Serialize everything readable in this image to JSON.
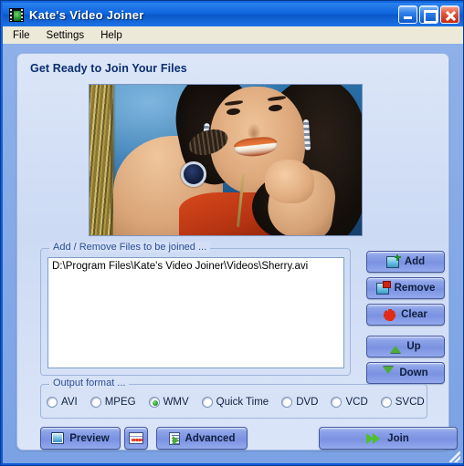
{
  "window": {
    "title": "Kate's Video Joiner",
    "app_icon": "film-app-icon",
    "controls": {
      "minimize": "minimize-icon",
      "maximize": "maximize-icon",
      "close": "close-icon"
    }
  },
  "menu": {
    "items": [
      {
        "label": "File"
      },
      {
        "label": "Settings"
      },
      {
        "label": "Help"
      }
    ]
  },
  "main": {
    "heading": "Get Ready to Join Your Files",
    "preview": {
      "name": "video-preview-thumbnail",
      "description": "Smiling woman with dark curly hair in orange top against blue backdrop"
    },
    "files_group": {
      "legend": "Add / Remove Files to be joined ...",
      "items": [
        "D:\\Program Files\\Kate's Video Joiner\\Videos\\Sherry.avi"
      ]
    },
    "side_buttons": [
      {
        "label": "Add",
        "icon": "add-image-icon"
      },
      {
        "label": "Remove",
        "icon": "remove-image-icon"
      },
      {
        "label": "Clear",
        "icon": "red-asterisk-icon"
      },
      {
        "label": "Up",
        "icon": "green-up-arrow-icon"
      },
      {
        "label": "Down",
        "icon": "green-down-arrow-icon"
      }
    ],
    "format_group": {
      "legend": "Output format ...",
      "selected": "WMV",
      "options": [
        {
          "label": "AVI",
          "selected": false
        },
        {
          "label": "MPEG",
          "selected": false
        },
        {
          "label": "WMV",
          "selected": true
        },
        {
          "label": "Quick Time",
          "selected": false
        },
        {
          "label": "DVD",
          "selected": false
        },
        {
          "label": "VCD",
          "selected": false
        },
        {
          "label": "SVCD",
          "selected": false
        }
      ]
    },
    "bottom_buttons": [
      {
        "label": "Preview",
        "icon": "monitor-icon"
      },
      {
        "label": "",
        "icon": "screen-settings-icon"
      },
      {
        "label": "Advanced",
        "icon": "document-play-icon"
      },
      {
        "label": "Join",
        "icon": "fast-forward-icon"
      }
    ]
  },
  "colors": {
    "titlebar": "#0d63dd",
    "panel": "#ccdaf4",
    "button": "#8da3e8",
    "accent_green": "#4cae3a",
    "legend_text": "#2b4f93",
    "close_button": "#e4563a"
  }
}
